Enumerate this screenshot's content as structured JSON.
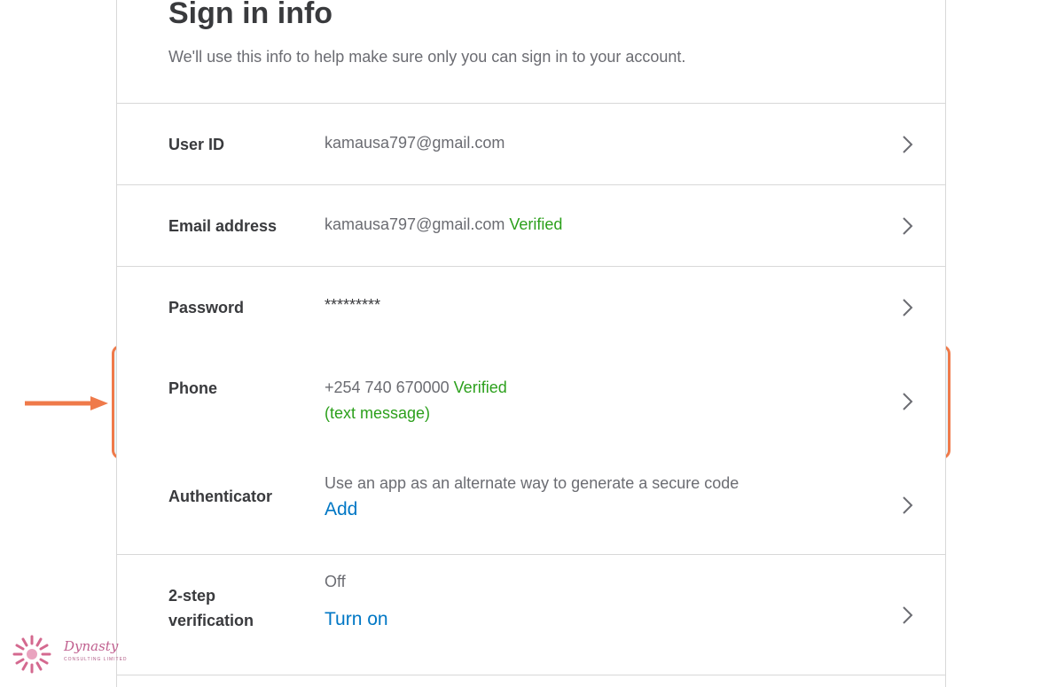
{
  "header": {
    "title": "Sign in info",
    "subtitle": "We'll use this info to help make sure only you can sign in to your account."
  },
  "rows": [
    {
      "label": "User ID",
      "value": "kamausa797@gmail.com"
    },
    {
      "label": "Email address",
      "value": "kamausa797@gmail.com",
      "status": "Verified"
    },
    {
      "label": "Password",
      "value": "*********"
    },
    {
      "label": "Phone",
      "value": "+254 740 670000",
      "status": "Verified",
      "note": "(text message)",
      "highlighted": true
    },
    {
      "label": "Authenticator",
      "value": "Use an app as an alternate way to generate a secure code",
      "action": "Add"
    },
    {
      "label_line1": "2-step",
      "label_line2": "verification",
      "value": "Off",
      "action": "Turn on"
    }
  ],
  "icons": {
    "chevron": "chevron-right-icon",
    "arrow": "arrow-right-icon"
  },
  "colors": {
    "verified": "#2ca01c",
    "link": "#0077c5",
    "highlight_border": "#ef7a4a",
    "highlight_fill": "#e9f6fb"
  },
  "logo": {
    "text": "Dynasty",
    "sub": "CONSULTING LIMITED"
  }
}
